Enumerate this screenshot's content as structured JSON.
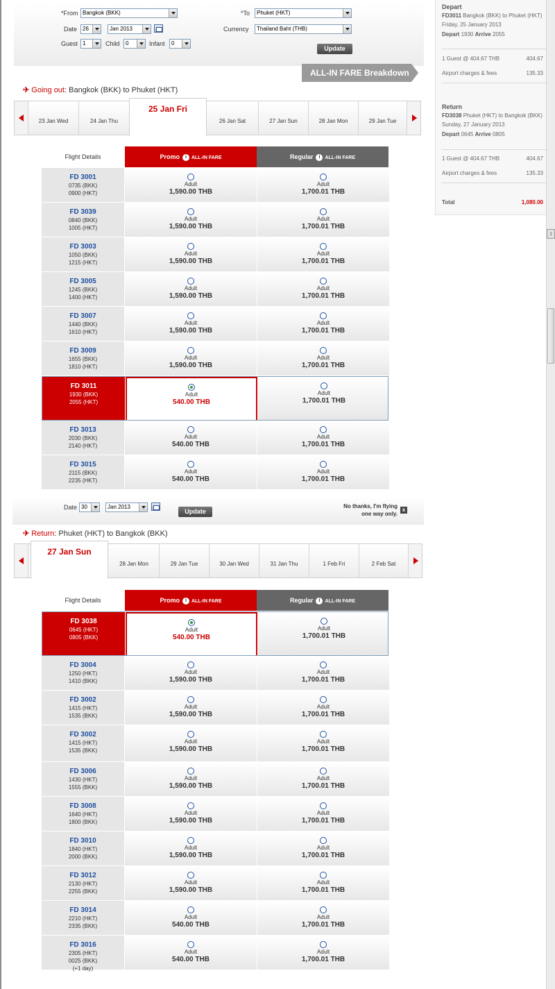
{
  "search": {
    "from_label": "*From",
    "from_value": "Bangkok (BKK)",
    "to_label": "*To",
    "to_value": "Phuket (HKT)",
    "date_label": "Date",
    "day_value": "26",
    "month_value": "Jan 2013",
    "currency_label": "Currency",
    "currency_value": "Thailand Baht (THB)",
    "guest_label": "Guest",
    "guest_value": "1",
    "child_label": "Child",
    "child_value": "0",
    "infant_label": "Infant",
    "infant_value": "0",
    "update_label": "Update"
  },
  "fare_breakdown_label": "ALL-IN FARE Breakdown",
  "outbound": {
    "route_lead": "Going out:",
    "from": "Bangkok (BKK)",
    "to_word": "to",
    "to": "Phuket (HKT)",
    "selected_date": "25 Jan Fri",
    "dates": [
      "23 Jan Wed",
      "24 Jan Thu",
      "26 Jan Sat",
      "27 Jan Sun",
      "28 Jan Mon",
      "29 Jan Tue"
    ],
    "flights": [
      {
        "fno": "FD 3001",
        "dep": "0735  (BKK)",
        "arr": "0900  (HKT)",
        "promo": "1,590.00 THB",
        "regular": "1,700.01 THB"
      },
      {
        "fno": "FD 3039",
        "dep": "0840  (BKK)",
        "arr": "1005  (HKT)",
        "promo": "1,590.00 THB",
        "regular": "1,700.01 THB"
      },
      {
        "fno": "FD 3003",
        "dep": "1050  (BKK)",
        "arr": "1215  (HKT)",
        "promo": "1,590.00 THB",
        "regular": "1,700.01 THB"
      },
      {
        "fno": "FD 3005",
        "dep": "1245  (BKK)",
        "arr": "1400  (HKT)",
        "promo": "1,590.00 THB",
        "regular": "1,700.01 THB"
      },
      {
        "fno": "FD 3007",
        "dep": "1440  (BKK)",
        "arr": "1610  (HKT)",
        "promo": "1,590.00 THB",
        "regular": "1,700.01 THB"
      },
      {
        "fno": "FD 3009",
        "dep": "1655  (BKK)",
        "arr": "1810  (HKT)",
        "promo": "1,590.00 THB",
        "regular": "1,700.01 THB"
      },
      {
        "fno": "FD 3011",
        "dep": "1930  (BKK)",
        "arr": "2055  (HKT)",
        "promo": "540.00 THB",
        "regular": "1,700.01 THB"
      },
      {
        "fno": "FD 3013",
        "dep": "2030  (BKK)",
        "arr": "2140  (HKT)",
        "promo": "540.00 THB",
        "regular": "1,700.01 THB"
      },
      {
        "fno": "FD 3015",
        "dep": "2115  (BKK)",
        "arr": "2235  (HKT)",
        "promo": "540.00 THB",
        "regular": "1,700.01 THB"
      }
    ]
  },
  "table_headers": {
    "flight_details": "Flight Details",
    "promo": "Promo",
    "regular": "Regular",
    "all_in": "ALL-IN FARE",
    "info": "i",
    "adult": "Adult"
  },
  "return_bar": {
    "date_label": "Date",
    "day_value": "30",
    "month_value": "Jan 2013",
    "update_label": "Update",
    "no_thanks_1": "No thanks, I'm flying",
    "no_thanks_2": "one way only.",
    "close": "x"
  },
  "inbound": {
    "route_lead": "Return:",
    "from": "Phuket (HKT)",
    "to_word": "to",
    "to": "Bangkok (BKK)",
    "selected_date": "27 Jan Sun",
    "dates": [
      "28 Jan Mon",
      "29 Jan Tue",
      "30 Jan Wed",
      "31 Jan Thu",
      "1 Feb Fri",
      "2 Feb Sat"
    ],
    "flights": [
      {
        "fno": "FD 3038",
        "dep": "0645  (HKT)",
        "arr": "0805  (BKK)",
        "promo": "540.00 THB",
        "regular": "1,700.01 THB"
      },
      {
        "fno": "FD 3004",
        "dep": "1250  (HKT)",
        "arr": "1410  (BKK)",
        "promo": "1,590.00 THB",
        "regular": "1,700.01 THB"
      },
      {
        "fno": "FD 3002",
        "dep": "1415  (HKT)",
        "arr": "1535  (BKK)",
        "promo": "1,590.00 THB",
        "regular": "1,700.01 THB"
      },
      {
        "fno": "FD 3002",
        "dep": "1415  (HKT)",
        "arr": "1535  (BKK)",
        "promo": "1,590.00 THB",
        "regular": "1,700.01 THB"
      },
      {
        "fno": "FD 3006",
        "dep": "1430  (HKT)",
        "arr": "1555  (BKK)",
        "promo": "1,590.00 THB",
        "regular": "1,700.01 THB"
      },
      {
        "fno": "FD 3008",
        "dep": "1640  (HKT)",
        "arr": "1800  (BKK)",
        "promo": "1,590.00 THB",
        "regular": "1,700.01 THB"
      },
      {
        "fno": "FD 3010",
        "dep": "1840  (HKT)",
        "arr": "2000  (BKK)",
        "promo": "1,590.00 THB",
        "regular": "1,700.01 THB"
      },
      {
        "fno": "FD 3012",
        "dep": "2130  (HKT)",
        "arr": "2255  (BKK)",
        "promo": "1,590.00 THB",
        "regular": "1,700.01 THB"
      },
      {
        "fno": "FD 3014",
        "dep": "2210  (HKT)",
        "arr": "2335  (BKK)",
        "promo": "540.00 THB",
        "regular": "1,700.01 THB"
      },
      {
        "fno": "FD 3016",
        "dep": "2305  (HKT)",
        "arr": "0025  (BKK)",
        "extra": "(+1 day)",
        "promo": "540.00 THB",
        "regular": "1,700.01 THB"
      }
    ]
  },
  "summary": {
    "depart_title": "Depart",
    "depart_flight": "FD3011",
    "depart_route": "Bangkok (BKK) to Phuket (HKT)",
    "depart_date": "Friday, 25 January 2013",
    "depart_word": "Depart",
    "depart_time": "1930",
    "arrive_word": "Arrive",
    "arrive_time": "2055",
    "guest_line": "1 Guest @ 404.67 THB",
    "guest_amount": "404.67",
    "charges_line": "Airport charges & fees",
    "charges_amount": "135.33",
    "return_title": "Return",
    "return_flight": "FD3038",
    "return_route": "Phuket (HKT) to Bangkok (BKK)",
    "return_date": "Sunday, 27 January 2013",
    "return_depart_time": "0645",
    "return_arrive_time": "0805",
    "ret_guest_line": "1 Guest @ 404.67 THB",
    "ret_guest_amount": "404.67",
    "ret_charges_line": "Airport charges & fees",
    "ret_charges_amount": "135.33",
    "total_label": "Total",
    "total_value": "1,080.00"
  },
  "scroll_toggle": "↕"
}
